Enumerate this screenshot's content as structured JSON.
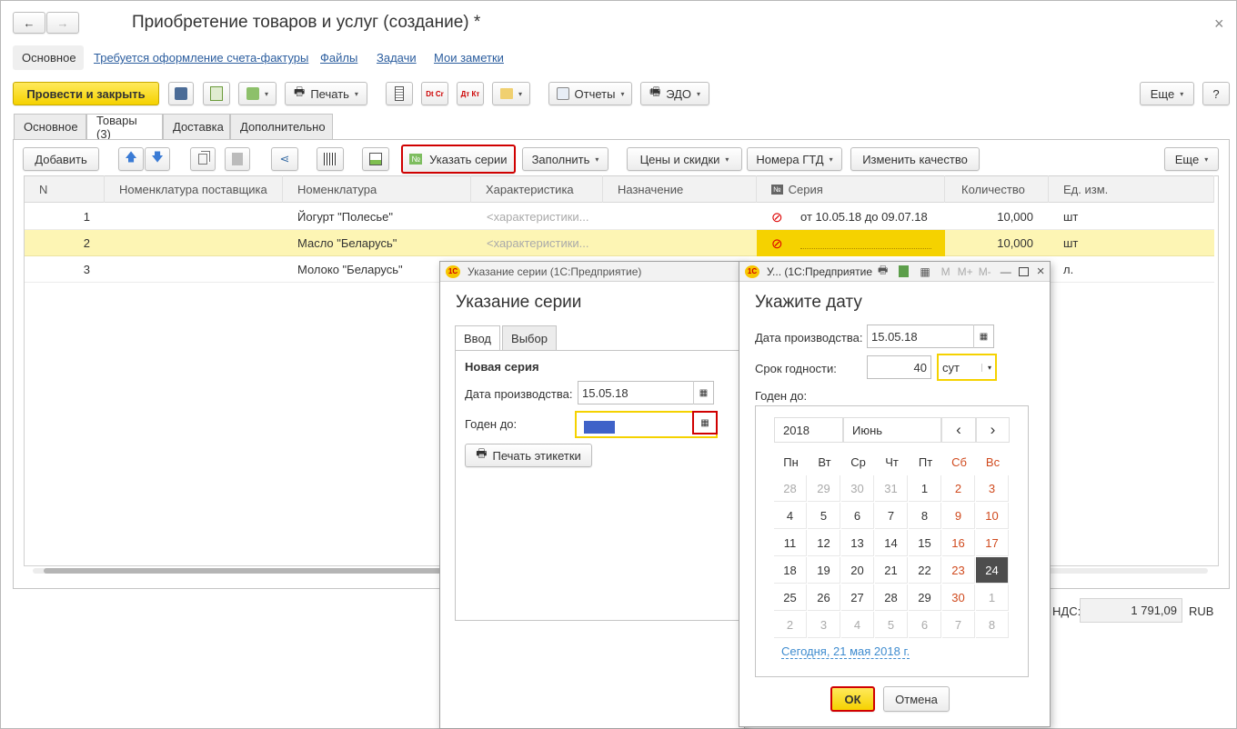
{
  "window": {
    "title": "Приобретение товаров и услуг (создание) *"
  },
  "nav_links": [
    "Основное",
    "Требуется оформление счета-фактуры",
    "Файлы",
    "Задачи",
    "Мои заметки"
  ],
  "toolbar": {
    "post_close": "Провести и закрыть",
    "print": "Печать",
    "reports": "Отчеты",
    "edo": "ЭДО",
    "more": "Еще",
    "help": "?",
    "dt_icon": "Dt Cr",
    "kt_icon": "Дт Кт"
  },
  "tabs": [
    "Основное",
    "Товары (3)",
    "Доставка",
    "Дополнительно"
  ],
  "goods_toolbar": {
    "add": "Добавить",
    "set_series": "Указать серии",
    "fill": "Заполнить",
    "prices": "Цены и скидки",
    "gtd": "Номера ГТД",
    "change_quality": "Изменить качество",
    "more": "Еще"
  },
  "table": {
    "headers": [
      "N",
      "Номенклатура поставщика",
      "Номенклатура",
      "Характеристика",
      "Назначение",
      "Серия",
      "Количество",
      "Ед. изм."
    ],
    "rows": [
      {
        "n": "1",
        "nom": "Йогурт \"Полесье\"",
        "char": "<характеристики...",
        "series": "от 10.05.18 до 09.07.18",
        "qty": "10,000",
        "unit": "шт"
      },
      {
        "n": "2",
        "nom": "Масло \"Беларусь\"",
        "char": "<характеристики...",
        "series": "",
        "qty": "10,000",
        "unit": "шт"
      },
      {
        "n": "3",
        "nom": "Молоко \"Беларусь\"",
        "char": "",
        "series": "",
        "qty": "",
        "unit": "л."
      }
    ]
  },
  "footer": {
    "vat_label": "НДС:",
    "vat_value": "1 791,09",
    "currency": "RUB"
  },
  "series_dialog": {
    "title": "Указание серии  (1С:Предприятие)",
    "heading": "Указание серии",
    "tabs": [
      "Ввод",
      "Выбор"
    ],
    "new_series": "Новая серия",
    "prod_date_label": "Дата производства:",
    "prod_date": "15.05.18",
    "valid_to_label": "Годен до:",
    "valid_to": "",
    "print_labels": "Печать этикетки"
  },
  "date_dialog": {
    "title": "У...  (1С:Предприятие",
    "title_icons": [
      "M",
      "M+",
      "M-"
    ],
    "heading": "Укажите дату",
    "prod_date_label": "Дата производства:",
    "prod_date": "15.05.18",
    "shelf_label": "Срок годности:",
    "shelf_value": "40",
    "shelf_unit": "сут",
    "valid_to_label": "Годен до:",
    "year": "2018",
    "month": "Июнь",
    "prev": "‹",
    "next": "›",
    "weekdays": [
      "Пн",
      "Вт",
      "Ср",
      "Чт",
      "Пт",
      "Сб",
      "Вс"
    ],
    "days": [
      [
        "28",
        "29",
        "30",
        "31",
        "1",
        "2",
        "3"
      ],
      [
        "4",
        "5",
        "6",
        "7",
        "8",
        "9",
        "10"
      ],
      [
        "11",
        "12",
        "13",
        "14",
        "15",
        "16",
        "17"
      ],
      [
        "18",
        "19",
        "20",
        "21",
        "22",
        "23",
        "24"
      ],
      [
        "25",
        "26",
        "27",
        "28",
        "29",
        "30",
        "1"
      ],
      [
        "2",
        "3",
        "4",
        "5",
        "6",
        "7",
        "8"
      ]
    ],
    "selected_day": "24",
    "today_link": "Сегодня, 21 мая 2018 г.",
    "ok": "ОК",
    "cancel": "Отмена"
  },
  "colors": {
    "accent_yellow": "#f5d200",
    "highlight_row": "#fdf5b4",
    "link": "#2b5d9e",
    "weekend": "#d04a1e",
    "red_frame": "#d00000",
    "selected_day": "#4d4d4d"
  }
}
